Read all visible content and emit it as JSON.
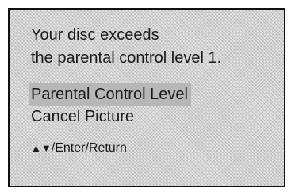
{
  "dialog": {
    "message_line1": "Your disc exceeds",
    "message_line2": "the parental control level 1.",
    "menu": [
      {
        "label": "Parental Control Level",
        "selected": true
      },
      {
        "label": "Cancel Picture",
        "selected": false
      }
    ],
    "hint": {
      "up_arrow": "▲",
      "down_arrow": "▼",
      "text": "/Enter/Return"
    }
  },
  "colors": {
    "selection_highlight": "#b7b7b7",
    "border": "#111111",
    "text": "#1a1a1a"
  }
}
